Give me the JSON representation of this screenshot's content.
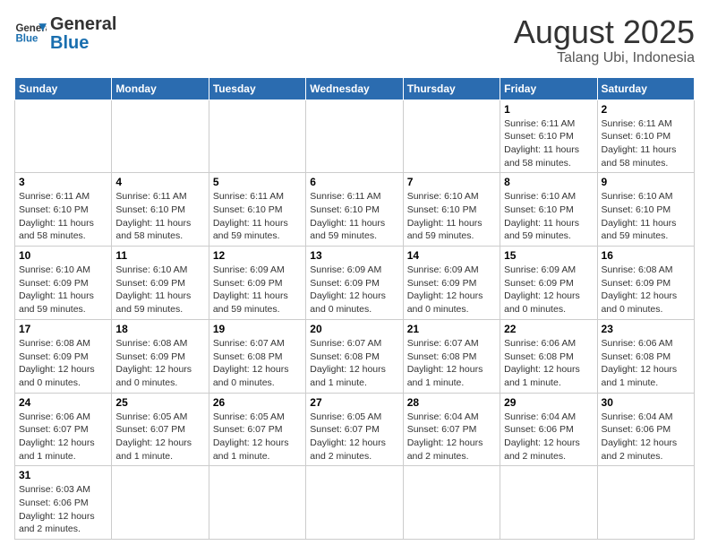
{
  "header": {
    "logo_general": "General",
    "logo_blue": "Blue",
    "month_year": "August 2025",
    "location": "Talang Ubi, Indonesia"
  },
  "weekdays": [
    "Sunday",
    "Monday",
    "Tuesday",
    "Wednesday",
    "Thursday",
    "Friday",
    "Saturday"
  ],
  "weeks": [
    [
      {
        "day": "",
        "info": ""
      },
      {
        "day": "",
        "info": ""
      },
      {
        "day": "",
        "info": ""
      },
      {
        "day": "",
        "info": ""
      },
      {
        "day": "",
        "info": ""
      },
      {
        "day": "1",
        "info": "Sunrise: 6:11 AM\nSunset: 6:10 PM\nDaylight: 11 hours\nand 58 minutes."
      },
      {
        "day": "2",
        "info": "Sunrise: 6:11 AM\nSunset: 6:10 PM\nDaylight: 11 hours\nand 58 minutes."
      }
    ],
    [
      {
        "day": "3",
        "info": "Sunrise: 6:11 AM\nSunset: 6:10 PM\nDaylight: 11 hours\nand 58 minutes."
      },
      {
        "day": "4",
        "info": "Sunrise: 6:11 AM\nSunset: 6:10 PM\nDaylight: 11 hours\nand 58 minutes."
      },
      {
        "day": "5",
        "info": "Sunrise: 6:11 AM\nSunset: 6:10 PM\nDaylight: 11 hours\nand 59 minutes."
      },
      {
        "day": "6",
        "info": "Sunrise: 6:11 AM\nSunset: 6:10 PM\nDaylight: 11 hours\nand 59 minutes."
      },
      {
        "day": "7",
        "info": "Sunrise: 6:10 AM\nSunset: 6:10 PM\nDaylight: 11 hours\nand 59 minutes."
      },
      {
        "day": "8",
        "info": "Sunrise: 6:10 AM\nSunset: 6:10 PM\nDaylight: 11 hours\nand 59 minutes."
      },
      {
        "day": "9",
        "info": "Sunrise: 6:10 AM\nSunset: 6:10 PM\nDaylight: 11 hours\nand 59 minutes."
      }
    ],
    [
      {
        "day": "10",
        "info": "Sunrise: 6:10 AM\nSunset: 6:09 PM\nDaylight: 11 hours\nand 59 minutes."
      },
      {
        "day": "11",
        "info": "Sunrise: 6:10 AM\nSunset: 6:09 PM\nDaylight: 11 hours\nand 59 minutes."
      },
      {
        "day": "12",
        "info": "Sunrise: 6:09 AM\nSunset: 6:09 PM\nDaylight: 11 hours\nand 59 minutes."
      },
      {
        "day": "13",
        "info": "Sunrise: 6:09 AM\nSunset: 6:09 PM\nDaylight: 12 hours\nand 0 minutes."
      },
      {
        "day": "14",
        "info": "Sunrise: 6:09 AM\nSunset: 6:09 PM\nDaylight: 12 hours\nand 0 minutes."
      },
      {
        "day": "15",
        "info": "Sunrise: 6:09 AM\nSunset: 6:09 PM\nDaylight: 12 hours\nand 0 minutes."
      },
      {
        "day": "16",
        "info": "Sunrise: 6:08 AM\nSunset: 6:09 PM\nDaylight: 12 hours\nand 0 minutes."
      }
    ],
    [
      {
        "day": "17",
        "info": "Sunrise: 6:08 AM\nSunset: 6:09 PM\nDaylight: 12 hours\nand 0 minutes."
      },
      {
        "day": "18",
        "info": "Sunrise: 6:08 AM\nSunset: 6:09 PM\nDaylight: 12 hours\nand 0 minutes."
      },
      {
        "day": "19",
        "info": "Sunrise: 6:07 AM\nSunset: 6:08 PM\nDaylight: 12 hours\nand 0 minutes."
      },
      {
        "day": "20",
        "info": "Sunrise: 6:07 AM\nSunset: 6:08 PM\nDaylight: 12 hours\nand 1 minute."
      },
      {
        "day": "21",
        "info": "Sunrise: 6:07 AM\nSunset: 6:08 PM\nDaylight: 12 hours\nand 1 minute."
      },
      {
        "day": "22",
        "info": "Sunrise: 6:06 AM\nSunset: 6:08 PM\nDaylight: 12 hours\nand 1 minute."
      },
      {
        "day": "23",
        "info": "Sunrise: 6:06 AM\nSunset: 6:08 PM\nDaylight: 12 hours\nand 1 minute."
      }
    ],
    [
      {
        "day": "24",
        "info": "Sunrise: 6:06 AM\nSunset: 6:07 PM\nDaylight: 12 hours\nand 1 minute."
      },
      {
        "day": "25",
        "info": "Sunrise: 6:05 AM\nSunset: 6:07 PM\nDaylight: 12 hours\nand 1 minute."
      },
      {
        "day": "26",
        "info": "Sunrise: 6:05 AM\nSunset: 6:07 PM\nDaylight: 12 hours\nand 1 minute."
      },
      {
        "day": "27",
        "info": "Sunrise: 6:05 AM\nSunset: 6:07 PM\nDaylight: 12 hours\nand 2 minutes."
      },
      {
        "day": "28",
        "info": "Sunrise: 6:04 AM\nSunset: 6:07 PM\nDaylight: 12 hours\nand 2 minutes."
      },
      {
        "day": "29",
        "info": "Sunrise: 6:04 AM\nSunset: 6:06 PM\nDaylight: 12 hours\nand 2 minutes."
      },
      {
        "day": "30",
        "info": "Sunrise: 6:04 AM\nSunset: 6:06 PM\nDaylight: 12 hours\nand 2 minutes."
      }
    ],
    [
      {
        "day": "31",
        "info": "Sunrise: 6:03 AM\nSunset: 6:06 PM\nDaylight: 12 hours\nand 2 minutes."
      },
      {
        "day": "",
        "info": ""
      },
      {
        "day": "",
        "info": ""
      },
      {
        "day": "",
        "info": ""
      },
      {
        "day": "",
        "info": ""
      },
      {
        "day": "",
        "info": ""
      },
      {
        "day": "",
        "info": ""
      }
    ]
  ]
}
